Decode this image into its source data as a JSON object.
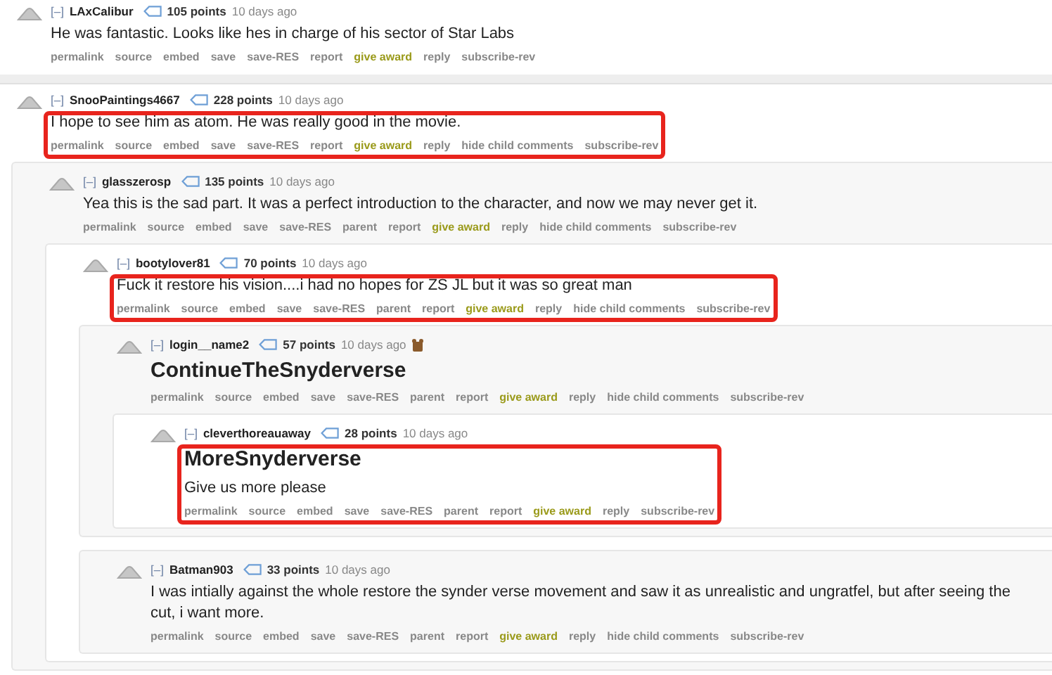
{
  "comments": [
    {
      "toggle": "[–]",
      "author": "LAxCalibur",
      "points": "105 points",
      "time": "10 days ago",
      "body": [
        {
          "kind": "text",
          "text": "He was fantastic. Looks like hes in charge of his sector of Star Labs"
        }
      ],
      "actions": [
        {
          "label": "permalink",
          "kind": "link"
        },
        {
          "label": "source",
          "kind": "link"
        },
        {
          "label": "embed",
          "kind": "link"
        },
        {
          "label": "save",
          "kind": "link"
        },
        {
          "label": "save-RES",
          "kind": "link"
        },
        {
          "label": "report",
          "kind": "link"
        },
        {
          "label": "give award",
          "kind": "award"
        },
        {
          "label": "reply",
          "kind": "link"
        },
        {
          "label": "subscribe-rev",
          "kind": "link"
        }
      ]
    },
    {
      "toggle": "[–]",
      "author": "SnooPaintings4667",
      "points": "228 points",
      "time": "10 days ago",
      "highlighted": true,
      "body": [
        {
          "kind": "text",
          "text": "I hope to see him as atom. He was really good in the movie."
        }
      ],
      "actions": [
        {
          "label": "permalink",
          "kind": "link"
        },
        {
          "label": "source",
          "kind": "link"
        },
        {
          "label": "embed",
          "kind": "link"
        },
        {
          "label": "save",
          "kind": "link"
        },
        {
          "label": "save-RES",
          "kind": "link"
        },
        {
          "label": "report",
          "kind": "link"
        },
        {
          "label": "give award",
          "kind": "award"
        },
        {
          "label": "reply",
          "kind": "link"
        },
        {
          "label": "hide child comments",
          "kind": "link"
        },
        {
          "label": "subscribe-rev",
          "kind": "link"
        }
      ],
      "children": [
        {
          "toggle": "[–]",
          "author": "glasszerosp",
          "points": "135 points",
          "time": "10 days ago",
          "body": [
            {
              "kind": "text",
              "text": "Yea this is the sad part. It was a perfect introduction to the character, and now we may never get it."
            }
          ],
          "actions": [
            {
              "label": "permalink",
              "kind": "link"
            },
            {
              "label": "source",
              "kind": "link"
            },
            {
              "label": "embed",
              "kind": "link"
            },
            {
              "label": "save",
              "kind": "link"
            },
            {
              "label": "save-RES",
              "kind": "link"
            },
            {
              "label": "parent",
              "kind": "link"
            },
            {
              "label": "report",
              "kind": "link"
            },
            {
              "label": "give award",
              "kind": "award"
            },
            {
              "label": "reply",
              "kind": "link"
            },
            {
              "label": "hide child comments",
              "kind": "link"
            },
            {
              "label": "subscribe-rev",
              "kind": "link"
            }
          ],
          "children": [
            {
              "toggle": "[–]",
              "author": "bootylover81",
              "points": "70 points",
              "time": "10 days ago",
              "highlighted": true,
              "body": [
                {
                  "kind": "text",
                  "text": "Fuck it restore his vision....i had no hopes for ZS JL but it was so great man"
                }
              ],
              "actions": [
                {
                  "label": "permalink",
                  "kind": "link"
                },
                {
                  "label": "source",
                  "kind": "link"
                },
                {
                  "label": "embed",
                  "kind": "link"
                },
                {
                  "label": "save",
                  "kind": "link"
                },
                {
                  "label": "save-RES",
                  "kind": "link"
                },
                {
                  "label": "parent",
                  "kind": "link"
                },
                {
                  "label": "report",
                  "kind": "link"
                },
                {
                  "label": "give award",
                  "kind": "award"
                },
                {
                  "label": "reply",
                  "kind": "link"
                },
                {
                  "label": "hide child comments",
                  "kind": "link"
                },
                {
                  "label": "subscribe-rev",
                  "kind": "link"
                }
              ],
              "children": [
                {
                  "toggle": "[–]",
                  "author": "login__name2",
                  "points": "57 points",
                  "time": "10 days ago",
                  "has_award": true,
                  "body": [
                    {
                      "kind": "heading",
                      "text": "ContinueTheSnyderverse"
                    }
                  ],
                  "actions": [
                    {
                      "label": "permalink",
                      "kind": "link"
                    },
                    {
                      "label": "source",
                      "kind": "link"
                    },
                    {
                      "label": "embed",
                      "kind": "link"
                    },
                    {
                      "label": "save",
                      "kind": "link"
                    },
                    {
                      "label": "save-RES",
                      "kind": "link"
                    },
                    {
                      "label": "parent",
                      "kind": "link"
                    },
                    {
                      "label": "report",
                      "kind": "link"
                    },
                    {
                      "label": "give award",
                      "kind": "award"
                    },
                    {
                      "label": "reply",
                      "kind": "link"
                    },
                    {
                      "label": "hide child comments",
                      "kind": "link"
                    },
                    {
                      "label": "subscribe-rev",
                      "kind": "link"
                    }
                  ],
                  "children": [
                    {
                      "toggle": "[–]",
                      "author": "cleverthoreauaway",
                      "points": "28 points",
                      "time": "10 days ago",
                      "highlighted": true,
                      "body": [
                        {
                          "kind": "heading",
                          "text": "MoreSnyderverse"
                        },
                        {
                          "kind": "text",
                          "text": "Give us more please"
                        }
                      ],
                      "actions": [
                        {
                          "label": "permalink",
                          "kind": "link"
                        },
                        {
                          "label": "source",
                          "kind": "link"
                        },
                        {
                          "label": "embed",
                          "kind": "link"
                        },
                        {
                          "label": "save",
                          "kind": "link"
                        },
                        {
                          "label": "save-RES",
                          "kind": "link"
                        },
                        {
                          "label": "parent",
                          "kind": "link"
                        },
                        {
                          "label": "report",
                          "kind": "link"
                        },
                        {
                          "label": "give award",
                          "kind": "award"
                        },
                        {
                          "label": "reply",
                          "kind": "link"
                        },
                        {
                          "label": "subscribe-rev",
                          "kind": "link"
                        }
                      ]
                    }
                  ]
                },
                {
                  "toggle": "[–]",
                  "author": "Batman903",
                  "points": "33 points",
                  "time": "10 days ago",
                  "body": [
                    {
                      "kind": "text",
                      "text": "I was intially against the whole restore the synder verse movement and saw it as unrealistic and ungratfel, but after seeing the cut, i want more."
                    }
                  ],
                  "actions": [
                    {
                      "label": "permalink",
                      "kind": "link"
                    },
                    {
                      "label": "source",
                      "kind": "link"
                    },
                    {
                      "label": "embed",
                      "kind": "link"
                    },
                    {
                      "label": "save",
                      "kind": "link"
                    },
                    {
                      "label": "save-RES",
                      "kind": "link"
                    },
                    {
                      "label": "parent",
                      "kind": "link"
                    },
                    {
                      "label": "report",
                      "kind": "link"
                    },
                    {
                      "label": "give award",
                      "kind": "award"
                    },
                    {
                      "label": "reply",
                      "kind": "link"
                    },
                    {
                      "label": "hide child comments",
                      "kind": "link"
                    },
                    {
                      "label": "subscribe-rev",
                      "kind": "link"
                    }
                  ]
                }
              ]
            }
          ]
        }
      ]
    }
  ]
}
